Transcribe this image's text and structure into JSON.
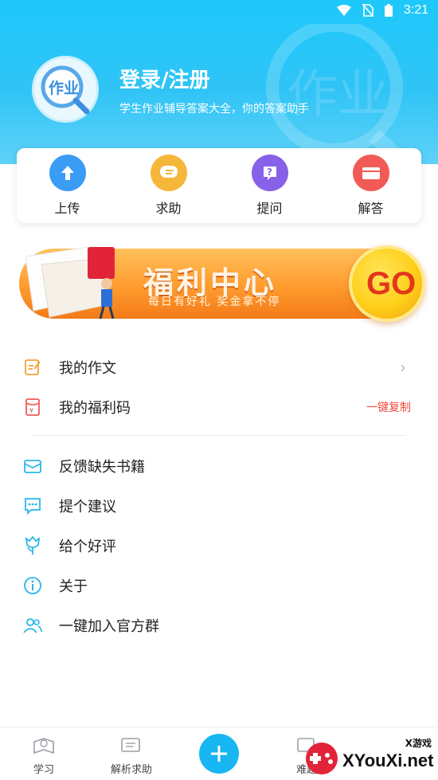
{
  "status_bar": {
    "time": "3:21"
  },
  "header": {
    "title": "登录/注册",
    "subtitle": "学生作业辅导答案大全，你的答案助手",
    "logo_text": "作业",
    "deco_text": "作业"
  },
  "quick_actions": [
    {
      "label": "上传",
      "icon": "upload-icon",
      "color": "#3a9cf5"
    },
    {
      "label": "求助",
      "icon": "chat-bubble-icon",
      "color": "#f6b63a"
    },
    {
      "label": "提问",
      "icon": "question-icon",
      "color": "#8761e8"
    },
    {
      "label": "解答",
      "icon": "folder-icon",
      "color": "#f25b55"
    }
  ],
  "banner": {
    "title": "福利中心",
    "subtitle": "每日有好礼  奖金拿不停",
    "go_label": "GO"
  },
  "menu": {
    "group1": [
      {
        "label": "我的作文",
        "icon": "edit-note-icon",
        "right": ""
      },
      {
        "label": "我的福利码",
        "icon": "yen-coupon-icon",
        "right": "一键复制"
      }
    ],
    "group2": [
      {
        "label": "反馈缺失书籍",
        "icon": "mail-icon"
      },
      {
        "label": "提个建议",
        "icon": "comment-dots-icon"
      },
      {
        "label": "给个好评",
        "icon": "flower-icon"
      },
      {
        "label": "关于",
        "icon": "info-icon"
      },
      {
        "label": "一键加入官方群",
        "icon": "group-icon"
      }
    ]
  },
  "tabbar": {
    "tabs": [
      {
        "label": "学习",
        "icon": "study-icon"
      },
      {
        "label": "解析求助",
        "icon": "help-icon"
      },
      {
        "label": "难题",
        "icon": "puzzle-icon"
      }
    ],
    "center_icon": "plus-icon"
  },
  "watermark": {
    "text": "XYouXi.net",
    "top_text": "X游戏"
  },
  "colors": {
    "header_blue": "#1ec8fb",
    "accent_red": "#ef4b3c",
    "menu_icon_blue": "#28b7e8",
    "menu_icon_orange": "#f2a23a"
  }
}
